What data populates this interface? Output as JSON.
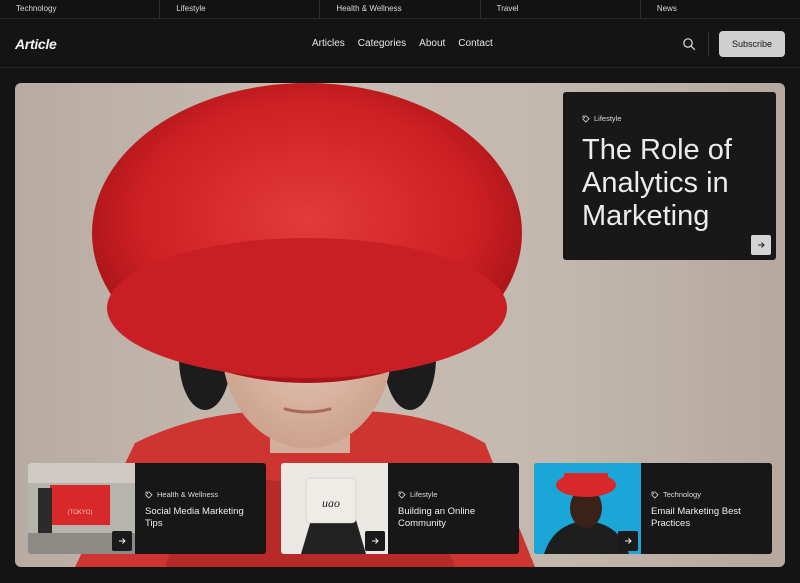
{
  "topbar": {
    "items": [
      "Technology",
      "Lifestyle",
      "Health & Wellness",
      "Travel",
      "News"
    ]
  },
  "header": {
    "logo": "Article",
    "nav": [
      "Articles",
      "Categories",
      "About",
      "Contact"
    ],
    "subscribe_label": "Subscribe"
  },
  "featured": {
    "tag": "Lifestyle",
    "title": "The Role of Analytics in Marketing"
  },
  "cards": [
    {
      "tag": "Health & Wellness",
      "title": "Social Media Marketing Tips",
      "thumb_text": "(TOKYO)"
    },
    {
      "tag": "Lifestyle",
      "title": "Building an Online Community",
      "thumb_text": "uao"
    },
    {
      "tag": "Technology",
      "title": "Email Marketing Best Practices"
    }
  ],
  "colors": {
    "background": "#141414",
    "accent_red": "#d8282a",
    "button": "#cfcfcf"
  }
}
